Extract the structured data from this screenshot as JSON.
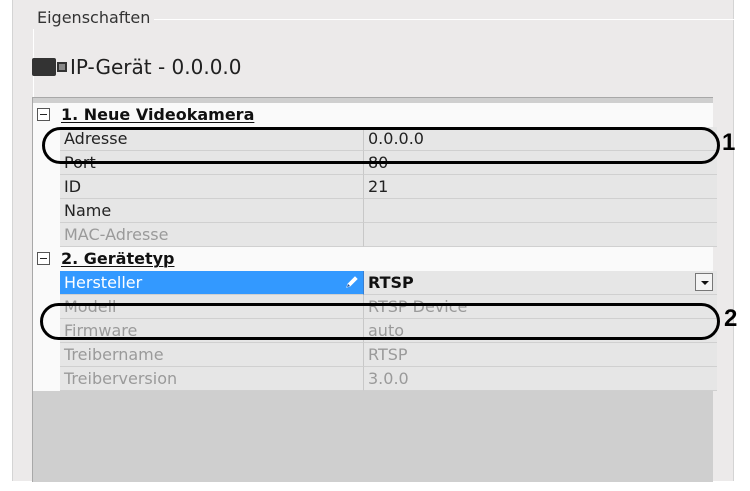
{
  "group_title": "Eigenschaften",
  "device": {
    "icon": "camera-icon",
    "title": "IP-Gerät - 0.0.0.0"
  },
  "categories": [
    {
      "label": "1. Neue Videokamera",
      "properties": [
        {
          "key": "Adresse",
          "value": "0.0.0.0",
          "disabled": false
        },
        {
          "key": "Port",
          "value": "80",
          "disabled": false
        },
        {
          "key": "ID",
          "value": "21",
          "disabled": false
        },
        {
          "key": "Name",
          "value": "",
          "disabled": false
        },
        {
          "key": "MAC-Adresse",
          "value": "",
          "disabled": true
        }
      ]
    },
    {
      "label": "2. Gerätetyp",
      "properties": [
        {
          "key": "Hersteller",
          "value": "RTSP",
          "selected": true,
          "dropdown": true
        },
        {
          "key": "Modell",
          "value": "RTSP Device",
          "disabled": true
        },
        {
          "key": "Firmware",
          "value": "auto",
          "disabled": true
        },
        {
          "key": "Treibername",
          "value": "RTSP",
          "disabled": true
        },
        {
          "key": "Treiberversion",
          "value": "3.0.0",
          "disabled": true
        }
      ]
    }
  ],
  "callouts": [
    {
      "label": "1"
    },
    {
      "label": "2"
    }
  ],
  "colors": {
    "selection": "#3399ff",
    "panel": "#eceaea",
    "row": "#e6e6e6"
  }
}
